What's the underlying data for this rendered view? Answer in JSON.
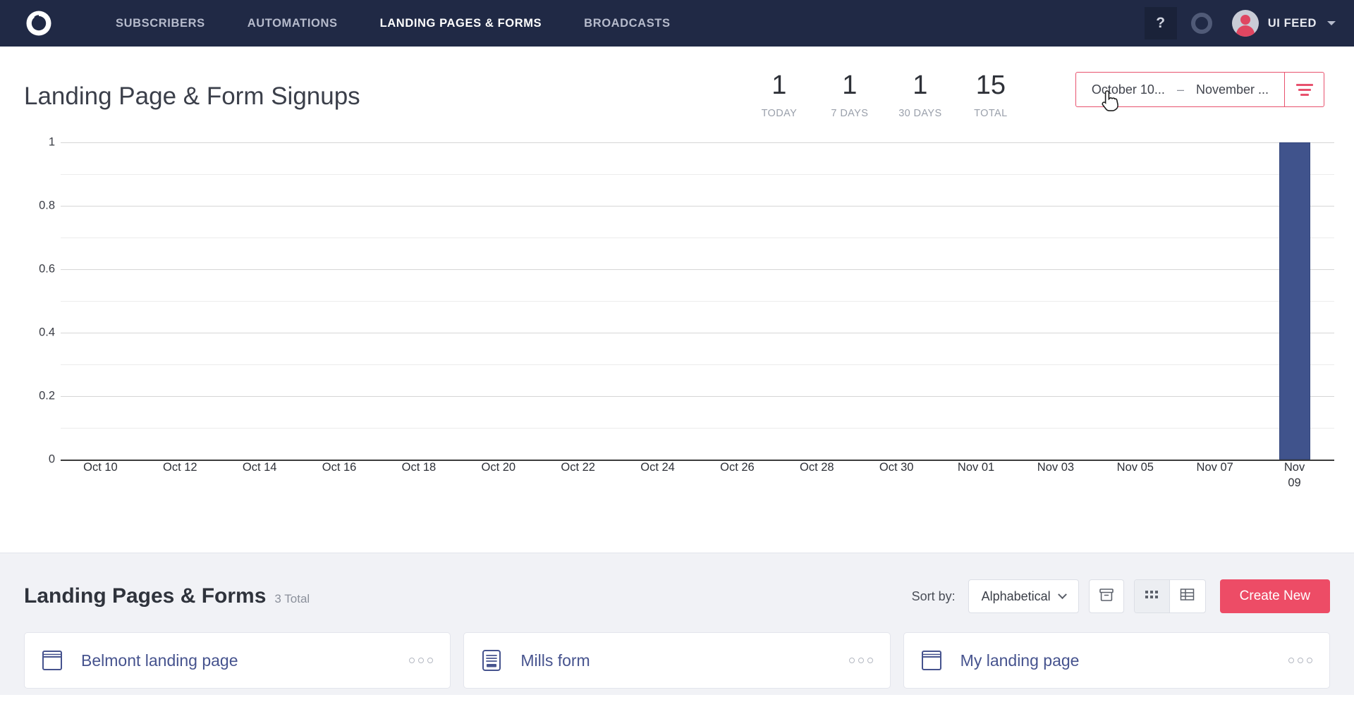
{
  "navbar": {
    "logo_icon": "convertkit-logo-icon",
    "links": [
      {
        "label": "SUBSCRIBERS",
        "active": false
      },
      {
        "label": "AUTOMATIONS",
        "active": false
      },
      {
        "label": "LANDING PAGES & FORMS",
        "active": true
      },
      {
        "label": "BROADCASTS",
        "active": false
      }
    ],
    "help_label": "?",
    "ring_icon": "circle-progress-icon",
    "account_name": "UI FEED",
    "account_caret_icon": "chevron-down-icon"
  },
  "header": {
    "title": "Landing Page & Form Signups",
    "stats": [
      {
        "value": "1",
        "label": "TODAY"
      },
      {
        "value": "1",
        "label": "7 DAYS"
      },
      {
        "value": "1",
        "label": "30 DAYS"
      },
      {
        "value": "15",
        "label": "TOTAL"
      }
    ],
    "date_range": {
      "start": "October 10...",
      "dash": "–",
      "end": "November ...",
      "filter_icon": "filter-lines-icon"
    }
  },
  "chart_data": {
    "type": "bar",
    "title": "Landing Page & Form Signups",
    "xlabel": "",
    "ylabel": "",
    "ylim": [
      0,
      1
    ],
    "ytick_labels": [
      "1",
      "0.8",
      "0.6",
      "0.4",
      "0.2",
      "0"
    ],
    "ytick_values": [
      1,
      0.8,
      0.6,
      0.4,
      0.2,
      0
    ],
    "minor_gridlines": [
      0.9,
      0.7,
      0.5,
      0.3,
      0.1
    ],
    "grid": true,
    "legend": "none",
    "bar_color": "#40538c",
    "categories": [
      "Oct 10",
      "Oct 12",
      "Oct 14",
      "Oct 16",
      "Oct 18",
      "Oct 20",
      "Oct 22",
      "Oct 24",
      "Oct 26",
      "Oct 28",
      "Oct 30",
      "Nov 01",
      "Nov 03",
      "Nov 05",
      "Nov 07",
      "Nov 09"
    ],
    "values": [
      0,
      0,
      0,
      0,
      0,
      0,
      0,
      0,
      0,
      0,
      0,
      0,
      0,
      0,
      0,
      1
    ]
  },
  "bottom": {
    "title": "Landing Pages & Forms",
    "count": "3 Total",
    "sort_label": "Sort by:",
    "sort_value": "Alphabetical",
    "sort_caret_icon": "chevron-down-icon",
    "archive_icon": "archive-box-icon",
    "grid_view_icon": "grid-view-icon",
    "table_view_icon": "table-view-icon",
    "create_label": "Create New",
    "cards": [
      {
        "title": "Belmont landing page",
        "icon": "landing-page-icon",
        "menu_icon": "ellipsis-icon"
      },
      {
        "title": "Mills form",
        "icon": "form-icon",
        "menu_icon": "ellipsis-icon"
      },
      {
        "title": "My landing page",
        "icon": "landing-page-icon",
        "menu_icon": "ellipsis-icon"
      }
    ]
  },
  "colors": {
    "nav_bg": "#202945",
    "accent_red": "#ed4c66",
    "bar_blue": "#40538c",
    "panel_bg": "#f1f2f6",
    "card_title": "#46538e"
  }
}
